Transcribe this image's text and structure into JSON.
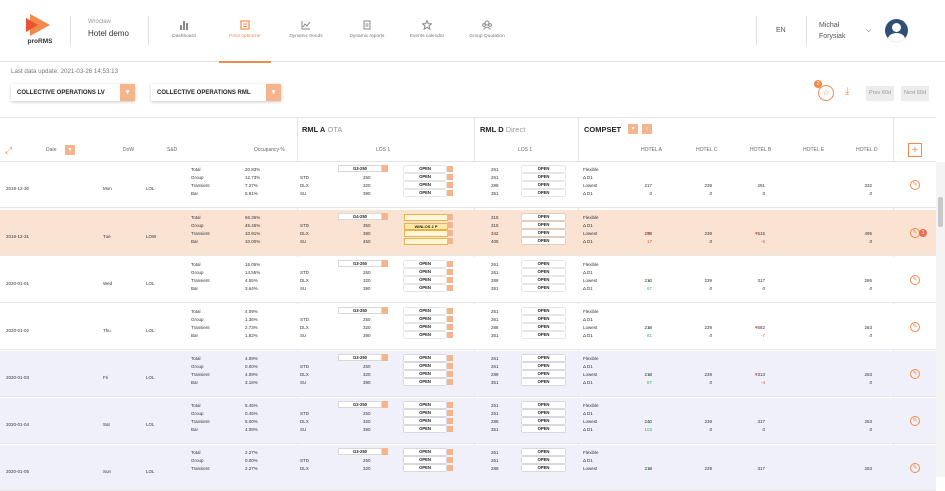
{
  "header": {
    "logo_text": "proRMS",
    "hotel_city": "Wrocław",
    "hotel_name": "Hotel demo",
    "nav": [
      {
        "label": "Dashboard",
        "icon": "bar-chart-icon",
        "active": false
      },
      {
        "label": "Price optimizer",
        "icon": "price-optimizer-icon",
        "active": true
      },
      {
        "label": "Dynamic trends",
        "icon": "line-chart-icon",
        "active": false
      },
      {
        "label": "Dynamic reports",
        "icon": "report-icon",
        "active": false
      },
      {
        "label": "Events calendar",
        "icon": "star-icon",
        "active": false
      },
      {
        "label": "Group Quotation",
        "icon": "group-icon",
        "active": false
      }
    ],
    "language": "EN",
    "user_first": "Michał",
    "user_last": "Forysiak"
  },
  "toolbar": {
    "last_update_label": "Last data update:",
    "last_update_value": "2021-03-26 14:53:13",
    "dropdown1": "COLLECTIVE OPERATIONS LV",
    "dropdown2": "COLLECTIVE OPERATIONS RML",
    "notif_count": "2",
    "prev_label": "Prev 60d",
    "next_label": "Next 60d"
  },
  "groups": {
    "rmla": "RML A",
    "rmla_sub": "OTA",
    "rmld": "RML D",
    "rmld_sub": "Direct",
    "compset": "COMPSET"
  },
  "columns": {
    "date": "Date",
    "dow": "DoW",
    "sd": "S&D",
    "occ": "Occupancy %",
    "los1a": "LOS 1",
    "los1d": "LOS 1",
    "hotel_a": "HOTEL A",
    "hotel_c": "HOTEL C",
    "hotel_b": "HOTEL B",
    "hotel_e": "HOTEL E",
    "hotel_d": "HOTEL D"
  },
  "seg_labels": [
    "Total",
    "Group",
    "Transient",
    "Bar"
  ],
  "room_labels": [
    "STD",
    "DLX",
    "SU"
  ],
  "comp_labels": [
    "Flexible",
    "Δ D1",
    "Lowest",
    "Δ D1"
  ],
  "rows": [
    {
      "date": "2019-12-30",
      "dow": "Mon",
      "sd": "LOL",
      "occ": [
        "20.83%",
        "12.73%",
        "7.27%",
        "5.91%"
      ],
      "rate": "G3-250",
      "rates": [
        "250",
        "320",
        "390"
      ],
      "stA": [
        "OPEN",
        "OPEN",
        "OPEN",
        "OPEN"
      ],
      "d": [
        "261",
        "261",
        "288",
        "351"
      ],
      "stD": [
        "OPEN",
        "OPEN",
        "OPEN",
        "OPEN"
      ],
      "ha": "217",
      "hadelta": "0",
      "hc": "239",
      "hcdelta": "0",
      "hb": "291",
      "hbdelta": "0",
      "hd": "332",
      "hddelta": "0",
      "tint": "white"
    },
    {
      "date": "2019-12-31",
      "dow": "Tue",
      "sd": "LOW",
      "occ": [
        "56.36%",
        "45.45%",
        "10.91%",
        "10.00%"
      ],
      "rate": "G4-250",
      "rates": [
        "350",
        "380",
        "450"
      ],
      "stA": [
        "",
        "WINLOS 2 P",
        "",
        ""
      ],
      "d": [
        "315",
        "315",
        "342",
        "405"
      ],
      "stD": [
        "OPEN",
        "OPEN",
        "OPEN",
        "OPEN"
      ],
      "ha": "298",
      "hadelta": "17",
      "hc": "239",
      "hcdelta": "0",
      "hb": "515",
      "hbdelta": "-6",
      "hd": "495",
      "hddelta": "0",
      "tint": "orange",
      "alert": "1"
    },
    {
      "date": "2020-01-01",
      "dow": "Wed",
      "sd": "LOL",
      "occ": [
        "15.05%",
        "14.55%",
        "4.55%",
        "3.64%"
      ],
      "rate": "G3-250",
      "rates": [
        "250",
        "320",
        "390"
      ],
      "stA": [
        "OPEN",
        "OPEN",
        "OPEN",
        "OPEN"
      ],
      "d": [
        "261",
        "261",
        "288",
        "351"
      ],
      "stD": [
        "OPEN",
        "OPEN",
        "OPEN",
        "OPEN"
      ],
      "ha": "210",
      "hadelta": "67",
      "hc": "239",
      "hcdelta": "0",
      "hb": "317",
      "hbdelta": "0",
      "hd": "286",
      "hddelta": "0",
      "tint": "white"
    },
    {
      "date": "2020-01-02",
      "dow": "Thu",
      "sd": "LOL",
      "occ": [
        "4.09%",
        "1.36%",
        "2.73%",
        "1.82%"
      ],
      "rate": "G3-250",
      "rates": [
        "250",
        "320",
        "390"
      ],
      "stA": [
        "OPEN",
        "OPEN",
        "OPEN",
        "OPEN"
      ],
      "d": [
        "261",
        "261",
        "288",
        "351"
      ],
      "stD": [
        "OPEN",
        "OPEN",
        "OPEN",
        "OPEN"
      ],
      "ha": "218",
      "hadelta": "81",
      "hc": "239",
      "hcdelta": "0",
      "hb": "682",
      "hbdelta": "-7",
      "hd": "263",
      "hddelta": "0",
      "tint": "white"
    },
    {
      "date": "2020-01-03",
      "dow": "Fri",
      "sd": "LOL",
      "occ": [
        "4.09%",
        "0.00%",
        "4.09%",
        "3.18%"
      ],
      "rate": "G3-250",
      "rates": [
        "250",
        "320",
        "390"
      ],
      "stA": [
        "OPEN",
        "OPEN",
        "OPEN",
        "OPEN"
      ],
      "d": [
        "261",
        "261",
        "288",
        "351"
      ],
      "stD": [
        "OPEN",
        "OPEN",
        "OPEN",
        "OPEN"
      ],
      "ha": "218",
      "hadelta": "87",
      "hc": "239",
      "hcdelta": "0",
      "hb": "313",
      "hbdelta": "-4",
      "hd": "263",
      "hddelta": "0",
      "tint": "blue"
    },
    {
      "date": "2020-01-04",
      "dow": "Sat",
      "sd": "LOL",
      "occ": [
        "5.45%",
        "0.45%",
        "5.00%",
        "4.09%"
      ],
      "rate": "G2-250",
      "rates": [
        "250",
        "320",
        "390"
      ],
      "stA": [
        "OPEN",
        "OPEN",
        "OPEN",
        "OPEN"
      ],
      "d": [
        "261",
        "261",
        "288",
        "351"
      ],
      "stD": [
        "OPEN",
        "OPEN",
        "OPEN",
        "OPEN"
      ],
      "ha": "240",
      "hadelta": "103",
      "hc": "239",
      "hcdelta": "0",
      "hb": "317",
      "hbdelta": "0",
      "hd": "263",
      "hddelta": "0",
      "tint": "blue"
    },
    {
      "date": "2020-01-05",
      "dow": "Sun",
      "sd": "LOL",
      "occ": [
        "2.27%",
        "0.00%",
        "2.27%",
        ""
      ],
      "rate": "G3-250",
      "rates": [
        "250",
        "320",
        ""
      ],
      "stA": [
        "OPEN",
        "OPEN",
        "OPEN",
        ""
      ],
      "d": [
        "261",
        "261",
        "288",
        ""
      ],
      "stD": [
        "OPEN",
        "OPEN",
        "OPEN",
        ""
      ],
      "ha": "218",
      "hadelta": "",
      "hc": "239",
      "hcdelta": "",
      "hb": "317",
      "hbdelta": "",
      "hd": "263",
      "hddelta": "",
      "tint": "blue"
    }
  ]
}
